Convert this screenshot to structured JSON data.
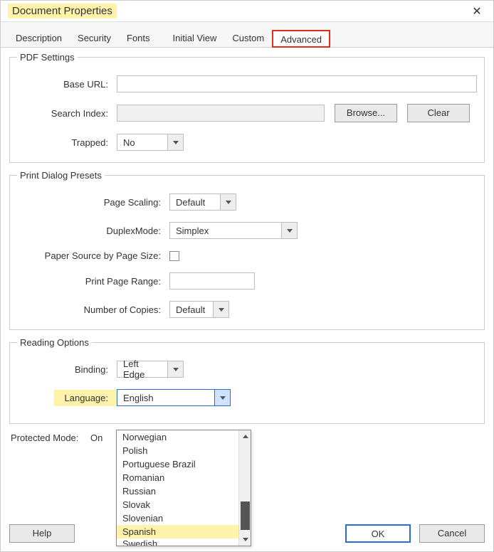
{
  "window": {
    "title": "Document Properties"
  },
  "tabs": {
    "t0": "Description",
    "t1": "Security",
    "t2": "Fonts",
    "t3": "Initial View",
    "t4": "Custom",
    "t5": "Advanced"
  },
  "pdf": {
    "legend": "PDF Settings",
    "base_url_label": "Base URL:",
    "base_url_value": "",
    "search_index_label": "Search Index:",
    "search_index_value": "",
    "browse_label": "Browse...",
    "clear_label": "Clear",
    "trapped_label": "Trapped:",
    "trapped_value": "No"
  },
  "print": {
    "legend": "Print Dialog Presets",
    "page_scaling_label": "Page Scaling:",
    "page_scaling_value": "Default",
    "duplex_label": "DuplexMode:",
    "duplex_value": "Simplex",
    "paper_source_label": "Paper Source by Page Size:",
    "print_range_label": "Print Page Range:",
    "print_range_value": "",
    "copies_label": "Number of Copies:",
    "copies_value": "Default"
  },
  "read": {
    "legend": "Reading Options",
    "binding_label": "Binding:",
    "binding_value": "Left Edge",
    "language_label": "Language:",
    "language_value": "English",
    "language_options": {
      "o0": "Norwegian",
      "o1": "Polish",
      "o2": "Portuguese Brazil",
      "o3": "Romanian",
      "o4": "Russian",
      "o5": "Slovak",
      "o6": "Slovenian",
      "o7": "Spanish",
      "o8": "Swedish"
    }
  },
  "protected": {
    "label": "Protected Mode:",
    "value": "On"
  },
  "footer": {
    "help": "Help",
    "ok": "OK",
    "cancel": "Cancel"
  }
}
